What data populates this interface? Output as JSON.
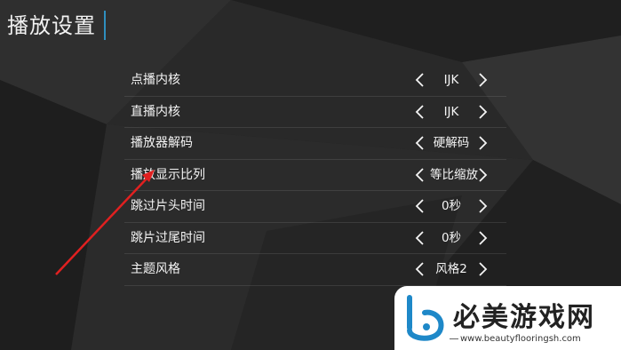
{
  "page": {
    "title": "播放设置"
  },
  "settings": [
    {
      "label": "点播内核",
      "value": "IJK"
    },
    {
      "label": "直播内核",
      "value": "IJK"
    },
    {
      "label": "播放器解码",
      "value": "硬解码"
    },
    {
      "label": "播放显示比列",
      "value": "等比缩放"
    },
    {
      "label": "跳过片头时间",
      "value": "0秒"
    },
    {
      "label": "跳片过尾时间",
      "value": "0秒"
    },
    {
      "label": "主题风格",
      "value": "风格2"
    }
  ],
  "icons": {
    "prev": "chevron-left-icon",
    "next": "chevron-right-icon"
  },
  "colors": {
    "accent": "#2f8fbf",
    "annotation_arrow": "#e02020"
  },
  "watermark": {
    "name": "必美游戏网",
    "url": "www.beautyflooringsh.com"
  }
}
